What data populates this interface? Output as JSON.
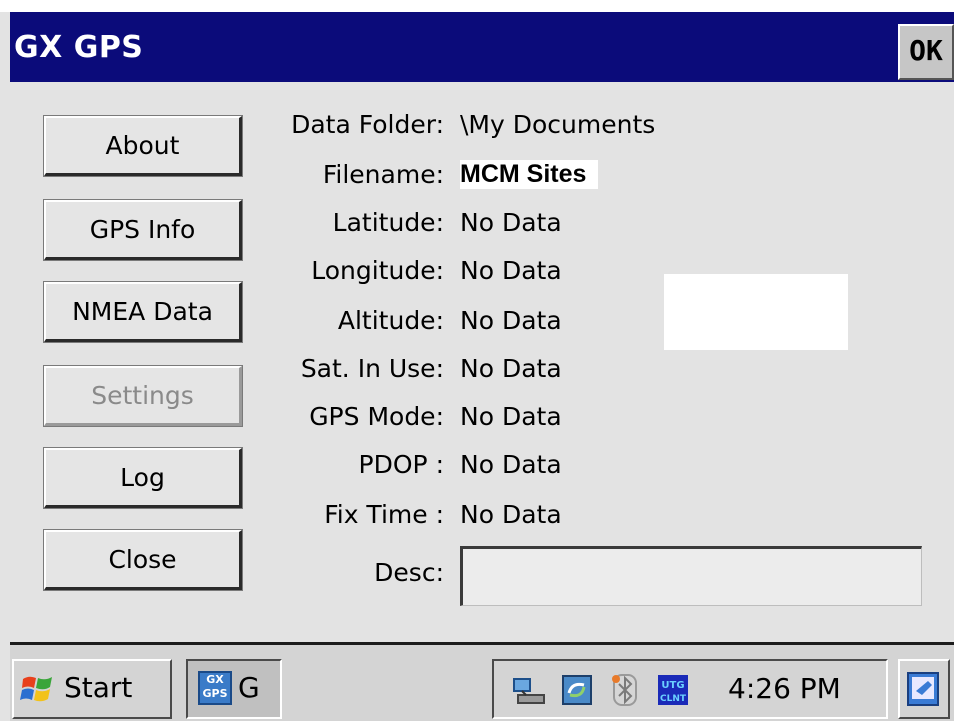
{
  "window": {
    "title": "GX GPS",
    "ok_label": "OK"
  },
  "buttons": {
    "about": "About",
    "gps_info": "GPS Info",
    "nmea_data": "NMEA Data",
    "settings": "Settings",
    "log": "Log",
    "close": "Close"
  },
  "fields": {
    "data_folder": {
      "label": "Data Folder:",
      "value": "\\My Documents"
    },
    "filename": {
      "label": "Filename:",
      "value": "MCM Sites"
    },
    "latitude": {
      "label": "Latitude:",
      "value": "No Data"
    },
    "longitude": {
      "label": "Longitude:",
      "value": "No Data"
    },
    "altitude": {
      "label": "Altitude:",
      "value": "No Data"
    },
    "sat_in_use": {
      "label": "Sat. In Use:",
      "value": "No Data"
    },
    "gps_mode": {
      "label": "GPS Mode:",
      "value": "No Data"
    },
    "pdop": {
      "label": "PDOP :",
      "value": "No Data"
    },
    "fix_time": {
      "label": "Fix Time :",
      "value": "No Data"
    },
    "desc": {
      "label": "Desc:",
      "value": ""
    }
  },
  "taskbar": {
    "start_label": "Start",
    "task_label": "G",
    "task_icon_text": "GX GPS",
    "clock": "4:26 PM",
    "tray_icons": [
      "network-icon",
      "sync-icon",
      "bluetooth-icon",
      "utg-client-icon"
    ]
  },
  "colors": {
    "titlebar": "#0b0b7a",
    "background": "#e3e3e3"
  }
}
